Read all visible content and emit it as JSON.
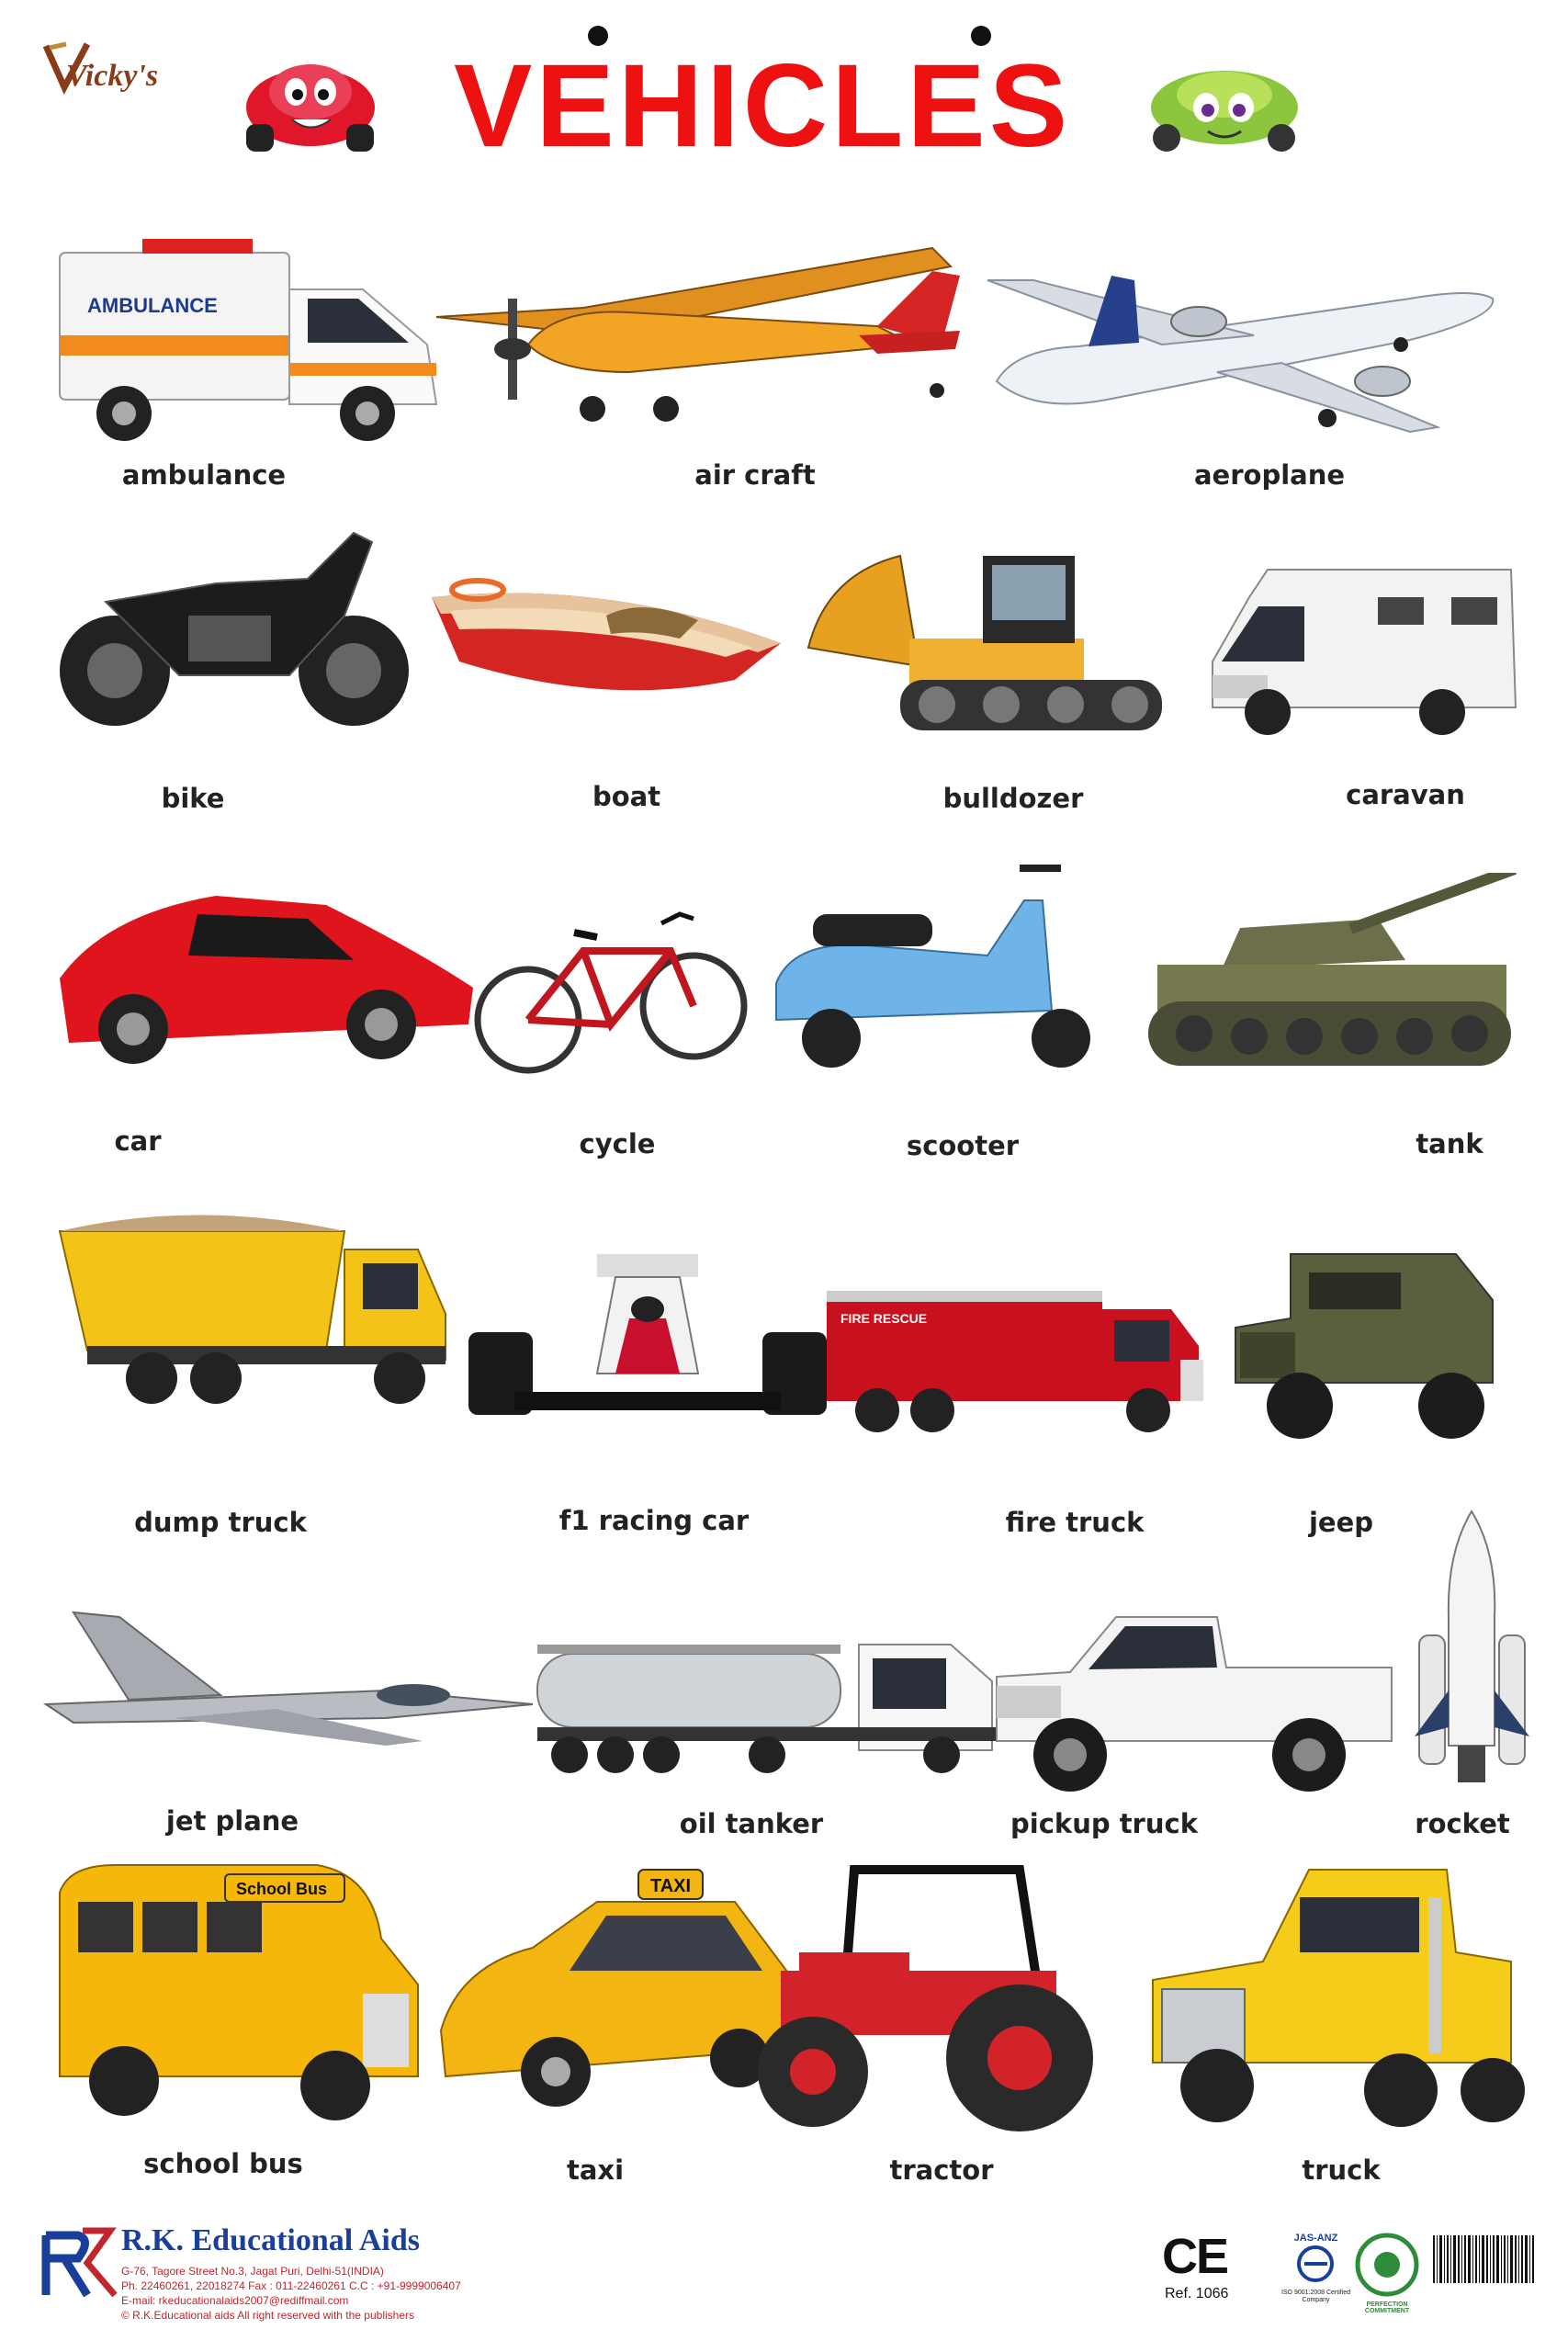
{
  "header": {
    "brand": "Vicky's",
    "title": "VEHICLES"
  },
  "vehicles": [
    {
      "label": "ambulance",
      "icon": "ambulance-icon"
    },
    {
      "label": "air craft",
      "icon": "propeller-plane-icon"
    },
    {
      "label": "aeroplane",
      "icon": "airliner-icon"
    },
    {
      "label": "bike",
      "icon": "motorbike-icon"
    },
    {
      "label": "boat",
      "icon": "boat-icon"
    },
    {
      "label": "bulldozer",
      "icon": "bulldozer-icon"
    },
    {
      "label": "caravan",
      "icon": "caravan-icon"
    },
    {
      "label": "car",
      "icon": "sports-car-icon"
    },
    {
      "label": "cycle",
      "icon": "bicycle-icon"
    },
    {
      "label": "scooter",
      "icon": "scooter-icon"
    },
    {
      "label": "tank",
      "icon": "tank-icon"
    },
    {
      "label": "dump truck",
      "icon": "dump-truck-icon"
    },
    {
      "label": "f1 racing car",
      "icon": "f1-car-icon"
    },
    {
      "label": "fire truck",
      "icon": "fire-truck-icon"
    },
    {
      "label": "jeep",
      "icon": "jeep-icon"
    },
    {
      "label": "jet plane",
      "icon": "fighter-jet-icon"
    },
    {
      "label": "oil tanker",
      "icon": "oil-tanker-icon"
    },
    {
      "label": "pickup truck",
      "icon": "pickup-truck-icon"
    },
    {
      "label": "rocket",
      "icon": "rocket-icon"
    },
    {
      "label": "school bus",
      "icon": "school-bus-icon"
    },
    {
      "label": "taxi",
      "icon": "taxi-icon"
    },
    {
      "label": "tractor",
      "icon": "tractor-icon"
    },
    {
      "label": "truck",
      "icon": "semi-truck-icon"
    }
  ],
  "image_text": {
    "ambulance_side": "AMBULANCE",
    "fire_truck_side": "FIRE RESCUE",
    "taxi_sign": "TAXI",
    "school_bus_sign": "School Bus"
  },
  "footer": {
    "company": "R.K. Educational Aids",
    "address": "G-76, Tagore Street No.3, Jagat Puri, Delhi-51(INDIA)",
    "phone": "Ph. 22460261, 22018274 Fax : 011-22460261 C.C : +91-9999006407",
    "email": "E-mail: rkeducationalaids2007@rediffmail.com",
    "rights": "© R.K.Educational aids  All right reserved with the publishers",
    "ce_mark": "CE",
    "ref": "Ref. 1066",
    "cert_jas": "JAS-ANZ",
    "cert_iso": "ISO 9001:2008 Certified Company",
    "cert_badge": "PERFECTION COMMITMENT"
  },
  "colors": {
    "title": "#ee1111",
    "company": "#1a3f9a",
    "address": "#c0262d"
  }
}
